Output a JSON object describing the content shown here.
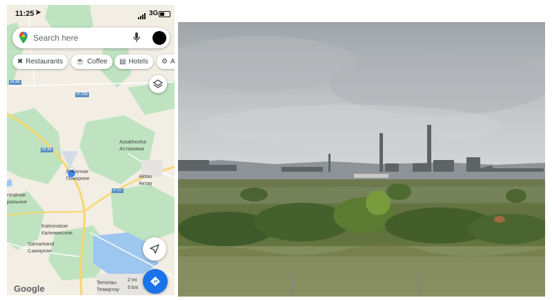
{
  "status": {
    "time": "11:25",
    "network": "3G"
  },
  "search": {
    "placeholder": "Search here"
  },
  "chips": [
    {
      "label": "Restaurants",
      "icon": "fork-knife-icon"
    },
    {
      "label": "Coffee",
      "icon": "coffee-cup-icon"
    },
    {
      "label": "Hotels",
      "icon": "bed-icon"
    },
    {
      "label": "A",
      "icon": "gear-icon"
    }
  ],
  "map": {
    "roads": {
      "r195": "R-195",
      "m36a": "M-36",
      "m36b": "M-36",
      "p37": "P-37",
      "m36edge": "M-36"
    },
    "places": {
      "astakhovka_en": "Astakhovka",
      "astakhovka_ru": "Астаховка",
      "pokornoe_en": "Pokornoe",
      "pokornoe_ru": "Покорное",
      "aktau_en": "Aktau",
      "aktau_ru": "Актау",
      "tsentralnoe_en": "ntralnoe",
      "tsentralnoe_ru": "ральное",
      "kalininskoe_en": "Kalininskoe",
      "kalininskoe_ru": "Калининское",
      "samarkand_en": "Samarkand",
      "samarkand_ru": "Самаркан",
      "temirtau_en": "Temirtau",
      "temirtau_ru": "Темиртау"
    },
    "scale": {
      "mi": "2 mi",
      "km": "5 km"
    },
    "attribution": "Google"
  },
  "colors": {
    "map_bg": "#f2eee4",
    "green": "#bfe3c0",
    "water": "#9ec7f0",
    "road": "#f7d66b",
    "accent_blue": "#1a73e8",
    "location_blue": "#4285f4"
  }
}
